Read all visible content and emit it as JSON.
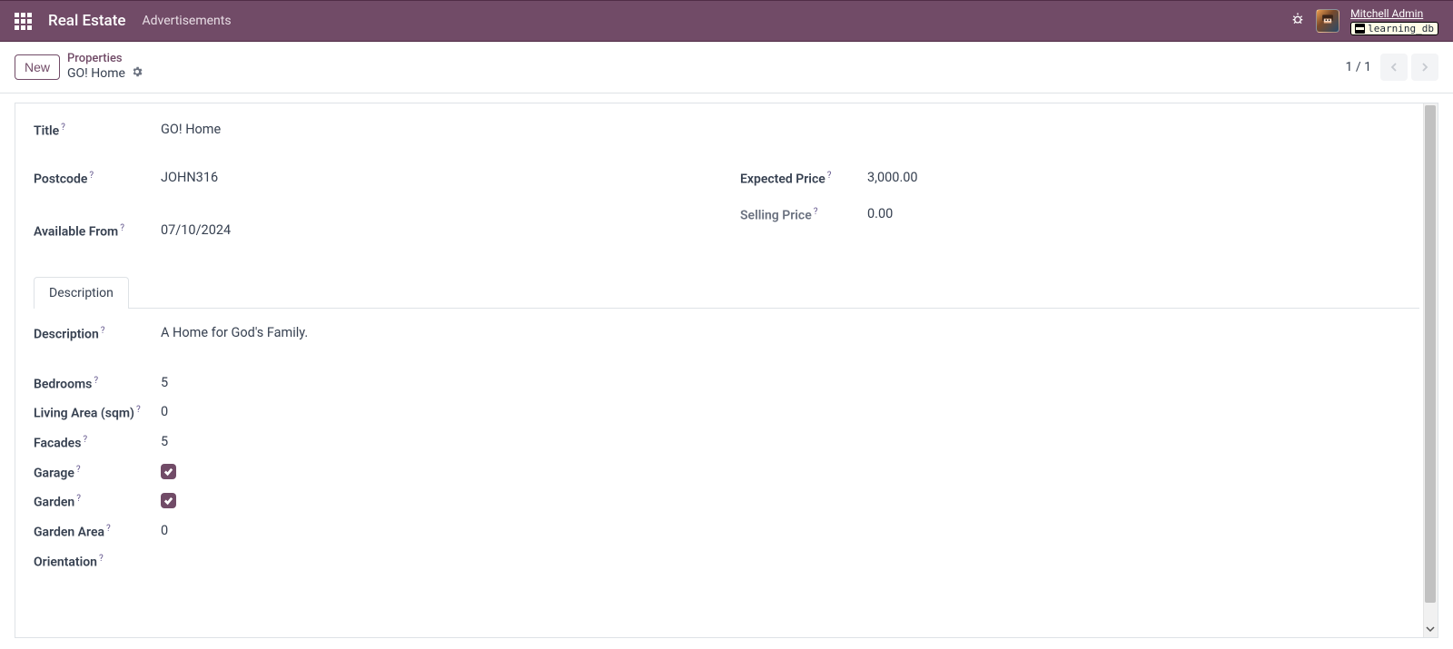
{
  "topbar": {
    "app_name": "Real Estate",
    "nav_link": "Advertisements",
    "user_name": "Mitchell Admin",
    "db_name": "learning_db"
  },
  "control_panel": {
    "new_button": "New",
    "breadcrumb_parent": "Properties",
    "breadcrumb_current": "GO! Home",
    "pager": "1 / 1"
  },
  "form": {
    "labels": {
      "title": "Title",
      "postcode": "Postcode",
      "available_from": "Available From",
      "expected_price": "Expected Price",
      "selling_price": "Selling Price",
      "description": "Description",
      "bedrooms": "Bedrooms",
      "living_area": "Living Area (sqm)",
      "facades": "Facades",
      "garage": "Garage",
      "garden": "Garden",
      "garden_area": "Garden Area",
      "orientation": "Orientation"
    },
    "values": {
      "title": "GO! Home",
      "postcode": "JOHN316",
      "available_from": "07/10/2024",
      "expected_price": "3,000.00",
      "selling_price": "0.00",
      "description": "A Home for God's Family.",
      "bedrooms": "5",
      "living_area": "0",
      "facades": "5",
      "garage": true,
      "garden": true,
      "garden_area": "0",
      "orientation": ""
    },
    "tabs": {
      "description": "Description"
    }
  }
}
